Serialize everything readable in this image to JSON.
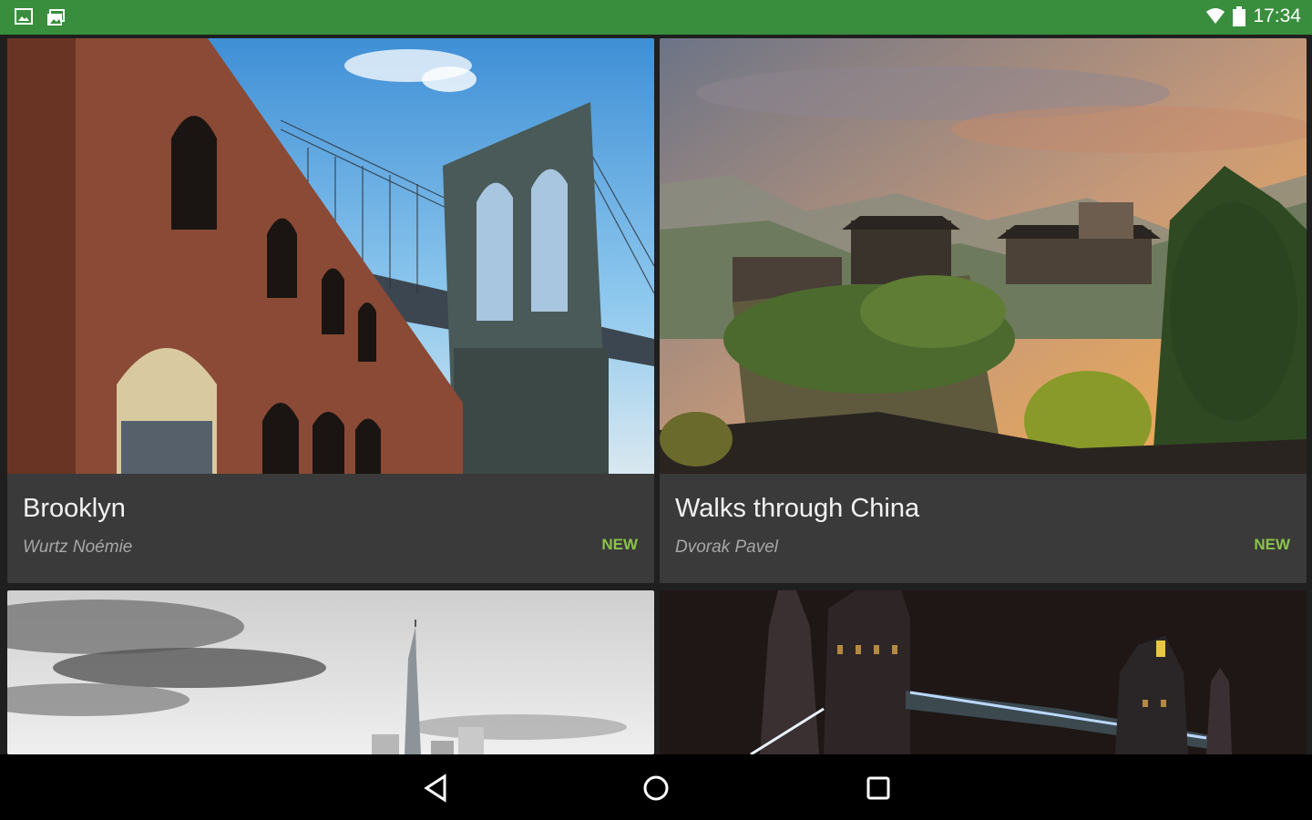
{
  "status_bar": {
    "time": "17:34",
    "icons": [
      "gallery-notification-icon",
      "photo-stack-notification-icon",
      "wifi-icon",
      "battery-icon"
    ],
    "color": "#388e3c"
  },
  "cards": [
    {
      "title": "Brooklyn",
      "author": "Wurtz Noémie",
      "badge": "NEW",
      "image": "brooklyn-bridge-photo"
    },
    {
      "title": "Walks through China",
      "author": "Dvorak Pavel",
      "badge": "NEW",
      "image": "china-village-photo"
    },
    {
      "title": "",
      "author": "",
      "badge": "",
      "image": "city-skyline-photo"
    },
    {
      "title": "",
      "author": "",
      "badge": "",
      "image": "tower-bridge-night-photo"
    }
  ],
  "nav_bar": {
    "buttons": [
      "back-icon",
      "home-icon",
      "recents-icon"
    ]
  },
  "colors": {
    "card_bg": "#3a3a3a",
    "badge": "#8bc34a",
    "title_text": "#f2f2f2",
    "author_text": "#a7a7a7"
  }
}
